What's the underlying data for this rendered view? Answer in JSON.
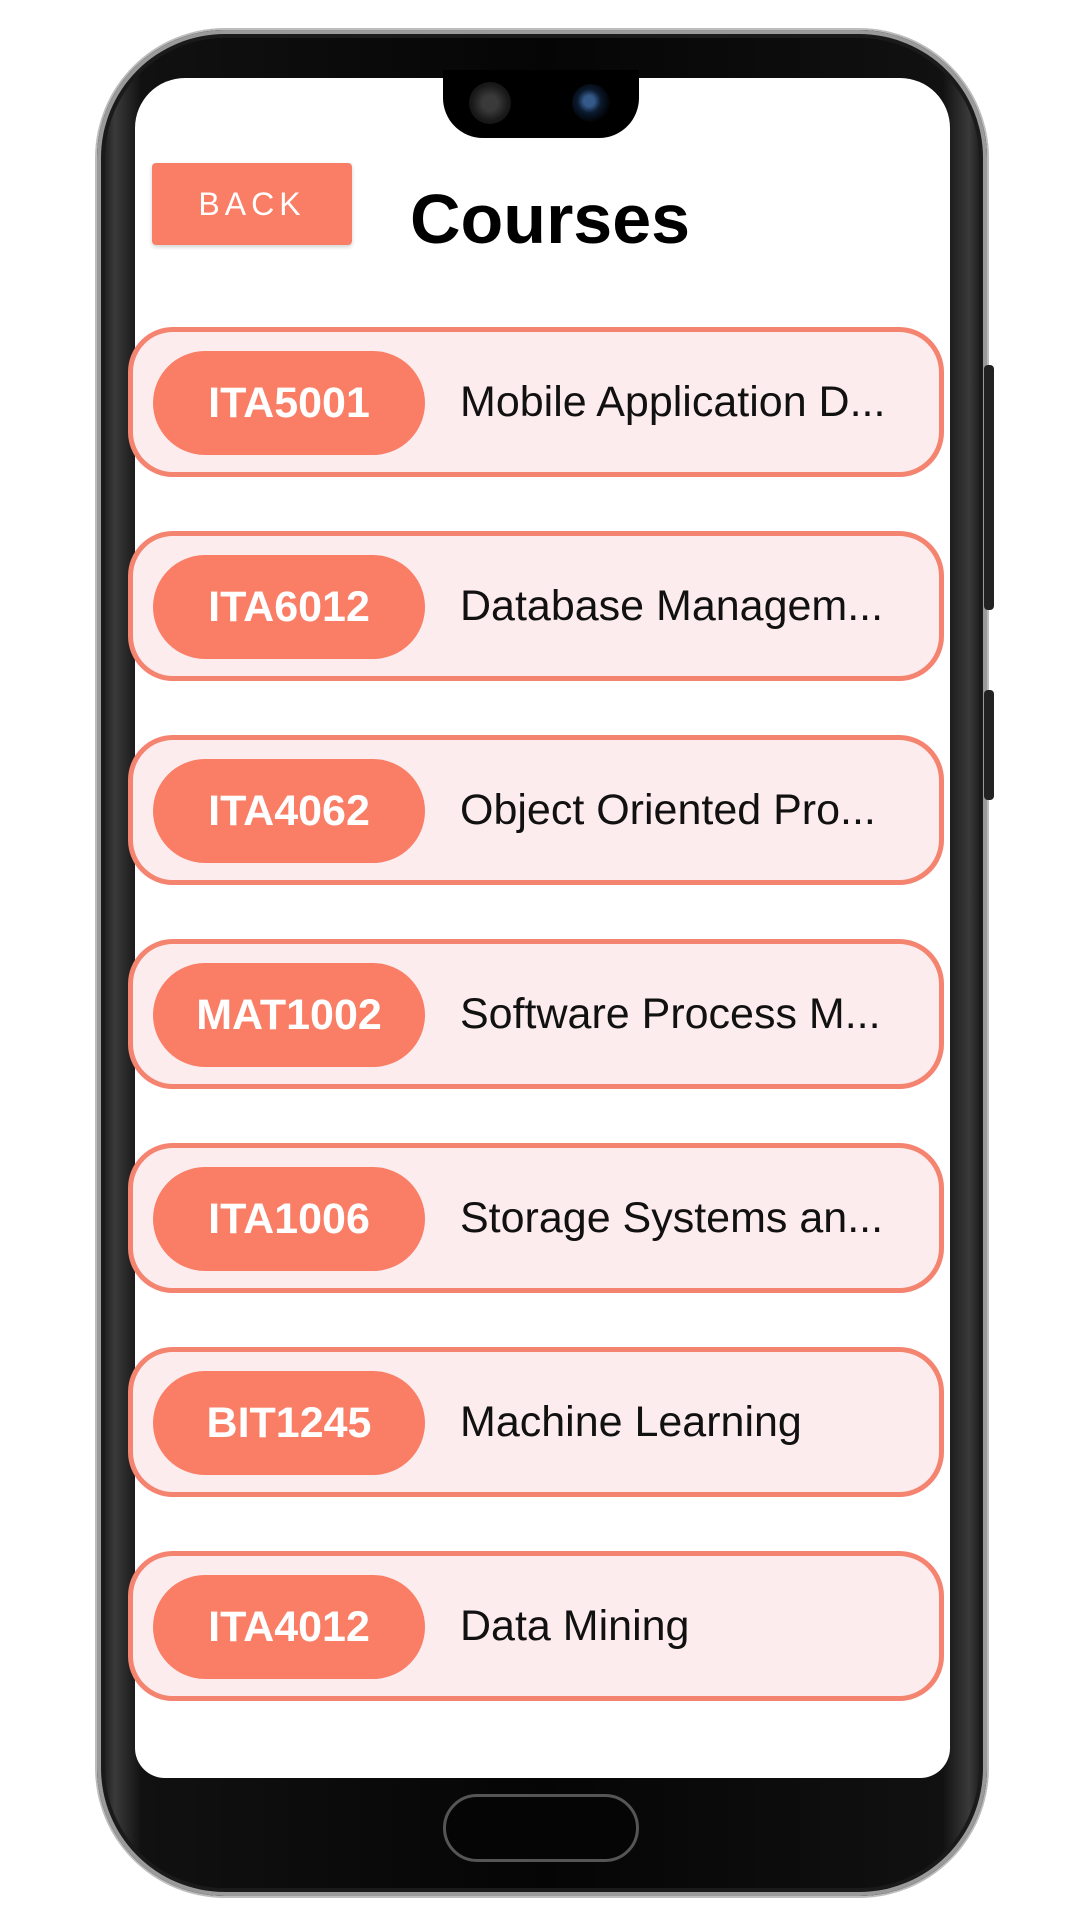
{
  "header": {
    "back_label": "BACK",
    "title": "Courses"
  },
  "courses": [
    {
      "code": "ITA5001",
      "name": "Mobile Application D..."
    },
    {
      "code": "ITA6012",
      "name": "Database Managem..."
    },
    {
      "code": "ITA4062",
      "name": "Object Oriented Pro..."
    },
    {
      "code": "MAT1002",
      "name": "Software Process M..."
    },
    {
      "code": "ITA1006",
      "name": "Storage Systems an..."
    },
    {
      "code": "BIT1245",
      "name": "Machine Learning"
    },
    {
      "code": "ITA4012",
      "name": "Data Mining"
    }
  ],
  "colors": {
    "accent": "#fa7d66",
    "card_background": "#fdeced",
    "card_border": "#f4836f"
  },
  "icons": {
    "front_camera": "camera-icon",
    "earpiece": "speaker-icon",
    "home": "home-button"
  }
}
